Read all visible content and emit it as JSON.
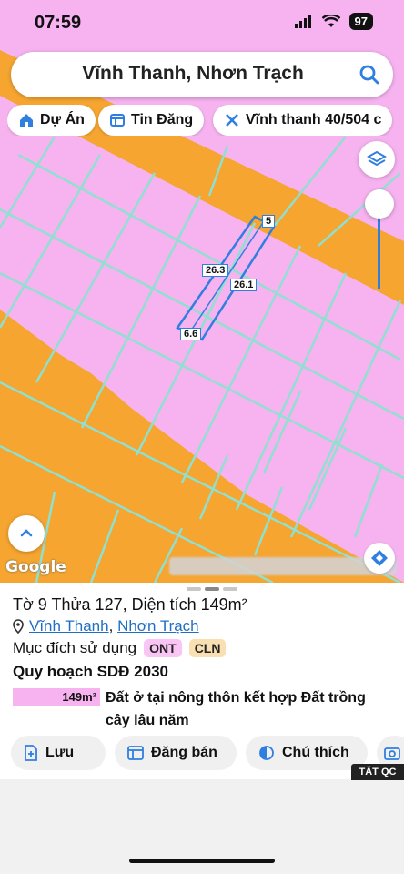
{
  "status": {
    "time": "07:59",
    "battery": "97"
  },
  "search": {
    "title": "Vĩnh Thanh, Nhơn Trạch"
  },
  "chips": [
    {
      "label": "Dự Án",
      "icon": "home-icon"
    },
    {
      "label": "Tin Đăng",
      "icon": "listing-icon"
    },
    {
      "label": "Vĩnh thanh 40/504 c",
      "icon": "ruler-icon"
    }
  ],
  "map": {
    "labels": [
      "5",
      "26.3",
      "26.1",
      "6.6"
    ],
    "attribution": "Google",
    "colors": {
      "residential": "#f6b3f0",
      "road": "#f5a530",
      "parcel_line": "#8fe0d0",
      "highlight": "#2f7fe0"
    }
  },
  "parcel": {
    "title": "Tờ 9 Thửa 127, Diện tích 149m²",
    "commune": "Vĩnh Thanh",
    "separator": ",",
    "district": "Nhơn Trạch",
    "purpose_label": "Mục đích sử dụng",
    "purpose_codes": [
      "ONT",
      "CLN"
    ],
    "plan_label": "Quy hoạch SDĐ 2030",
    "plan_area": "149m²",
    "plan_desc": "Đất ở tại nông thôn kết hợp Đất trồng cây lâu năm"
  },
  "actions": [
    {
      "label": "Lưu"
    },
    {
      "label": "Đăng bán"
    },
    {
      "label": "Chú thích"
    }
  ],
  "ad_tag": "TẮT QC"
}
